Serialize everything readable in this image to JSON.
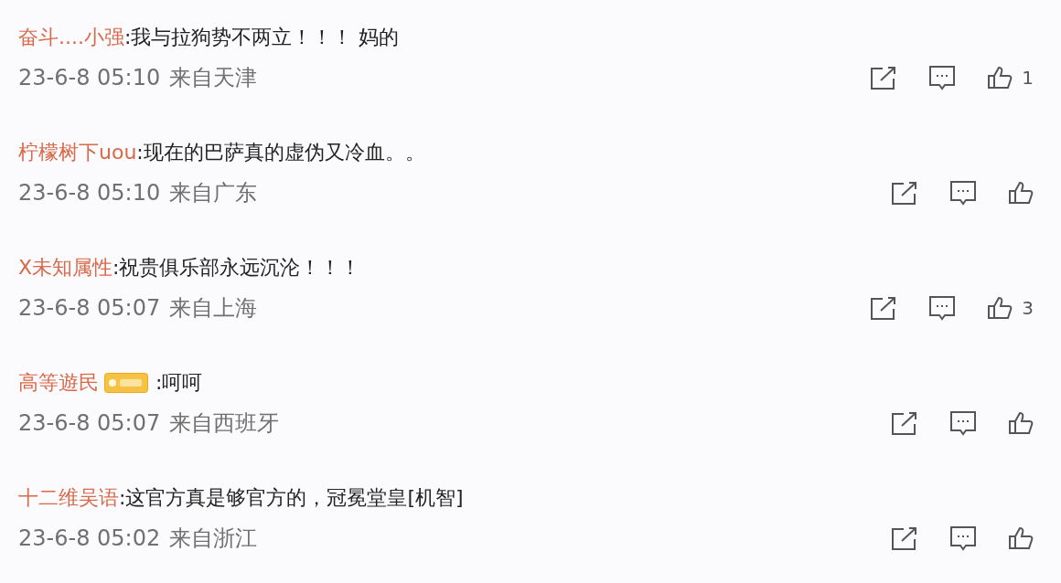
{
  "comments": [
    {
      "user": "奋斗....小强",
      "badge": false,
      "text": ":我与拉狗势不两立！！！ 妈的",
      "time": "23-6-8 05:10",
      "location": "来自天津",
      "likes": "1"
    },
    {
      "user": "柠檬树下uou",
      "badge": false,
      "text": ":现在的巴萨真的虚伪又冷血。。",
      "time": "23-6-8 05:10",
      "location": "来自广东"
    },
    {
      "user": "X未知属性",
      "badge": false,
      "text": ":祝贵俱乐部永远沉沦！！！",
      "time": "23-6-8 05:07",
      "location": "来自上海",
      "likes": "3"
    },
    {
      "user": "高等遊民",
      "badge": true,
      "text": ":呵呵",
      "time": "23-6-8 05:07",
      "location": "来自西班牙"
    },
    {
      "user": "十二维吴语",
      "badge": false,
      "text": ":这官方真是够官方的，冠冕堂皇[机智]",
      "time": "23-6-8 05:02",
      "location": "来自浙江"
    }
  ]
}
